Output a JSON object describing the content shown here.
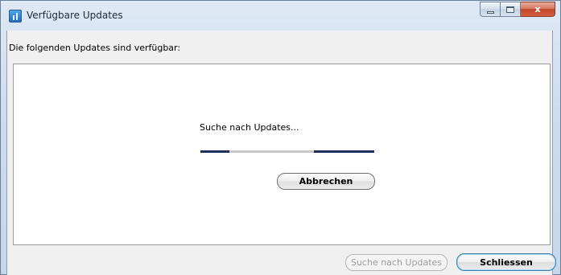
{
  "window": {
    "title": "Verfügbare Updates",
    "close_glyph": "x"
  },
  "heading": "Die folgenden Updates sind verfügbar:",
  "status": {
    "text": "Suche nach Updates..."
  },
  "buttons": {
    "cancel": "Abbrechen",
    "search_updates": "Suche nach Updates",
    "close": "Schliessen"
  },
  "icons": {
    "app": "app-updates-icon",
    "minimize": "minimize-icon",
    "maximize": "maximize-icon",
    "close": "close-icon"
  },
  "colors": {
    "progress_fill": "#1e2d5a",
    "progress_track": "#c8c8c8",
    "close_button": "#c2452a"
  }
}
